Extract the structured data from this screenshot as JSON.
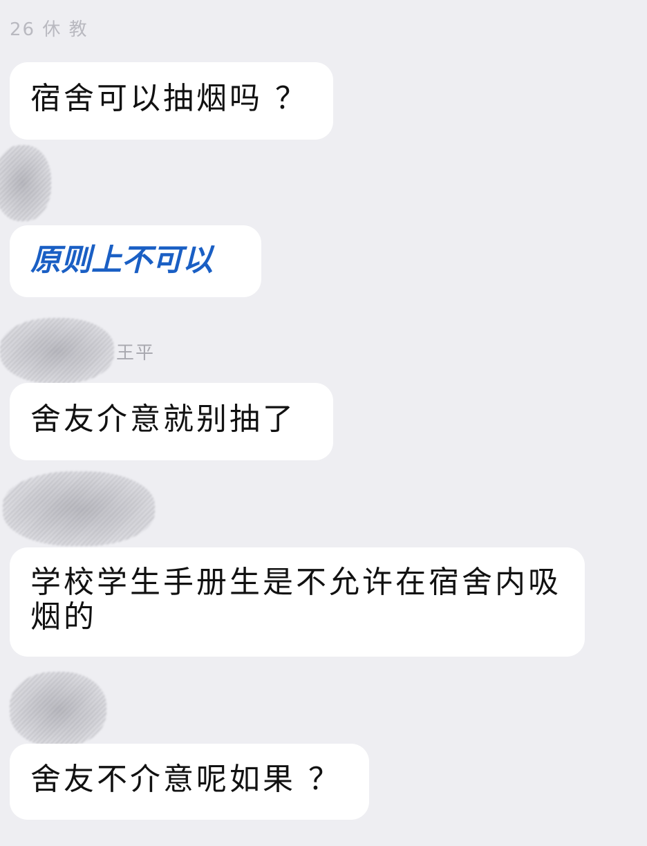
{
  "messages": [
    {
      "sender": "26 休 教",
      "text": "宿舍可以抽烟吗 ？"
    },
    {
      "sender": "",
      "text": "原则上不可以",
      "color": "#1a5fc4"
    },
    {
      "sender": "王平",
      "text": "舍友介意就别抽了"
    },
    {
      "sender": "",
      "text": "学校学生手册生是不允许在宿舍内吸烟的"
    },
    {
      "sender": "",
      "text": "舍友不介意呢如果 ？"
    }
  ]
}
